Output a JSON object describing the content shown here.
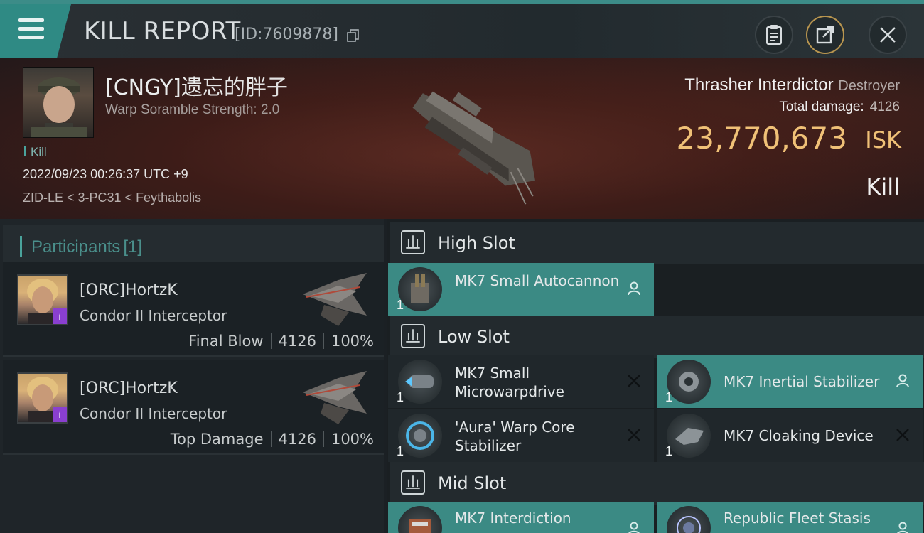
{
  "header": {
    "title": "KILL REPORT",
    "report_id": "[ID:7609878]"
  },
  "victim": {
    "name": "[CNGY]遗忘的胖子",
    "subtitle": "Warp Soramble Strength: 2.0",
    "kill_tag": "Kill",
    "datetime": "2022/09/23 00:26:37 UTC +9",
    "location": "ZID-LE < 3-PC31 < Feythabolis"
  },
  "ship": {
    "name": "Thrasher Interdictor",
    "class": "Destroyer",
    "total_damage_label": "Total damage:",
    "total_damage": "4126",
    "isk_value": "23,770,673",
    "isk_unit": "ISK",
    "result": "Kill"
  },
  "participants": {
    "title": "Participants",
    "count": "[1]",
    "rows": [
      {
        "name": "[ORC]HortzK",
        "ship": "Condor II Interceptor",
        "role": "Final Blow",
        "damage": "4126",
        "percent": "100%",
        "badge": "i"
      },
      {
        "name": "[ORC]HortzK",
        "ship": "Condor II Interceptor",
        "role": "Top Damage",
        "damage": "4126",
        "percent": "100%",
        "badge": "i"
      }
    ]
  },
  "slots": {
    "high": {
      "title": "High Slot",
      "modules": [
        {
          "name": "MK7 Small Autocannon",
          "qty": "1",
          "icon": "autocannon-icon",
          "status": "person-icon"
        }
      ]
    },
    "low": {
      "title": "Low Slot",
      "modules": [
        {
          "name": "MK7 Small Microwarpdrive",
          "qty": "1",
          "icon": "microwarpdrive-icon",
          "status": "destroyed-icon"
        },
        {
          "name": "MK7 Inertial Stabilizer",
          "qty": "1",
          "icon": "inertial-stabilizer-icon",
          "status": "person-icon"
        },
        {
          "name": "'Aura' Warp Core Stabilizer",
          "qty": "1",
          "icon": "warp-core-stabilizer-icon",
          "status": "destroyed-icon"
        },
        {
          "name": "MK7 Cloaking Device",
          "qty": "1",
          "icon": "cloaking-device-icon",
          "status": "destroyed-icon"
        }
      ]
    },
    "mid": {
      "title": "Mid Slot",
      "modules": [
        {
          "name": "MK7 Interdiction",
          "icon": "interdiction-icon",
          "status": "person-icon"
        },
        {
          "name": "Republic Fleet Stasis",
          "icon": "stasis-icon",
          "status": "person-icon"
        }
      ]
    }
  },
  "colors": {
    "accent": "#3b8a84",
    "isk": "#f0c177",
    "hero_bg": "#3d1c18",
    "panel_bg": "#1f2529"
  }
}
